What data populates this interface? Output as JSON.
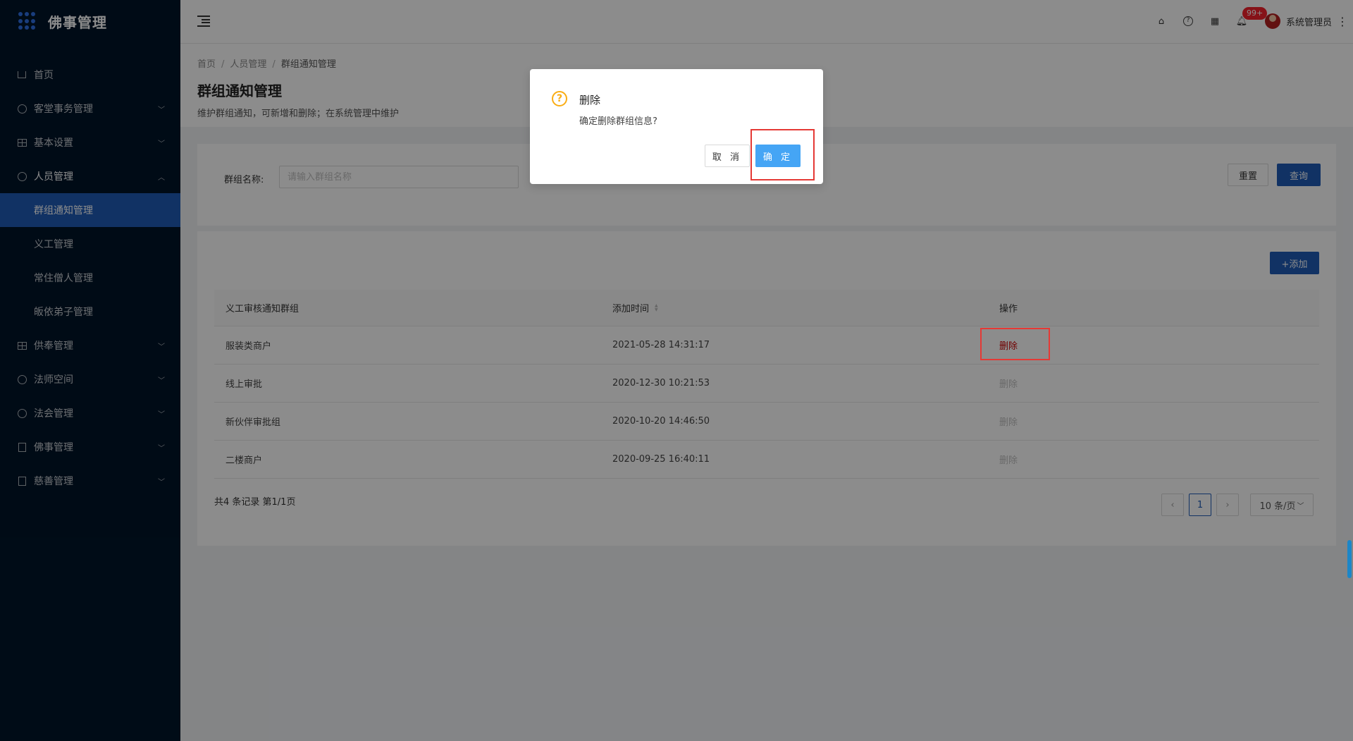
{
  "app": {
    "title": "佛事管理"
  },
  "sidebar": {
    "items": [
      {
        "label": "首页",
        "icon": "home-icon",
        "has_children": false
      },
      {
        "label": "客堂事务管理",
        "icon": "dashboard-icon",
        "has_children": true
      },
      {
        "label": "基本设置",
        "icon": "table-icon",
        "has_children": true
      },
      {
        "label": "人员管理",
        "icon": "check-circle-icon",
        "has_children": true,
        "open": true,
        "children": [
          {
            "label": "群组通知管理",
            "active": true
          },
          {
            "label": "义工管理"
          },
          {
            "label": "常住僧人管理"
          },
          {
            "label": "皈依弟子管理"
          }
        ]
      },
      {
        "label": "供奉管理",
        "icon": "table-icon",
        "has_children": true
      },
      {
        "label": "法师空间",
        "icon": "check-circle-icon",
        "has_children": true
      },
      {
        "label": "法会管理",
        "icon": "check-circle-icon",
        "has_children": true
      },
      {
        "label": "佛事管理",
        "icon": "profile-icon",
        "has_children": true
      },
      {
        "label": "慈善管理",
        "icon": "edit-icon",
        "has_children": true
      }
    ]
  },
  "header": {
    "notification_badge": "99+",
    "username": "系统管理员"
  },
  "breadcrumb": [
    "首页",
    "人员管理",
    "群组通知管理"
  ],
  "page": {
    "title": "群组通知管理",
    "description": "维护群组通知，可新增和删除；在系统管理中维护"
  },
  "search": {
    "label": "群组名称:",
    "placeholder": "请输入群组名称",
    "value": "",
    "reset_label": "重置",
    "query_label": "查询"
  },
  "table": {
    "add_label": "+添加",
    "columns": [
      "义工审核通知群组",
      "添加时间",
      "操作"
    ],
    "rows": [
      {
        "name": "服装类商户",
        "time": "2021-05-28 14:31:17",
        "action": "删除",
        "action_active": true
      },
      {
        "name": "线上审批",
        "time": "2020-12-30 10:21:53",
        "action": "删除",
        "action_active": false
      },
      {
        "name": "新伙伴审批组",
        "time": "2020-10-20 14:46:50",
        "action": "删除",
        "action_active": false
      },
      {
        "name": "二楼商户",
        "time": "2020-09-25 16:40:11",
        "action": "删除",
        "action_active": false
      }
    ],
    "footer": "共4 条记录 第1/1页",
    "pagination": {
      "current": "1",
      "page_size": "10 条/页"
    }
  },
  "modal": {
    "title": "删除",
    "content": "确定删除群组信息?",
    "cancel_label": "取 消",
    "ok_label": "确 定"
  },
  "colors": {
    "sidebar_bg": "#001529",
    "primary": "#1f5cb7",
    "danger": "#cc0000",
    "warning": "#faad14",
    "ok_button": "#45a5f5"
  }
}
